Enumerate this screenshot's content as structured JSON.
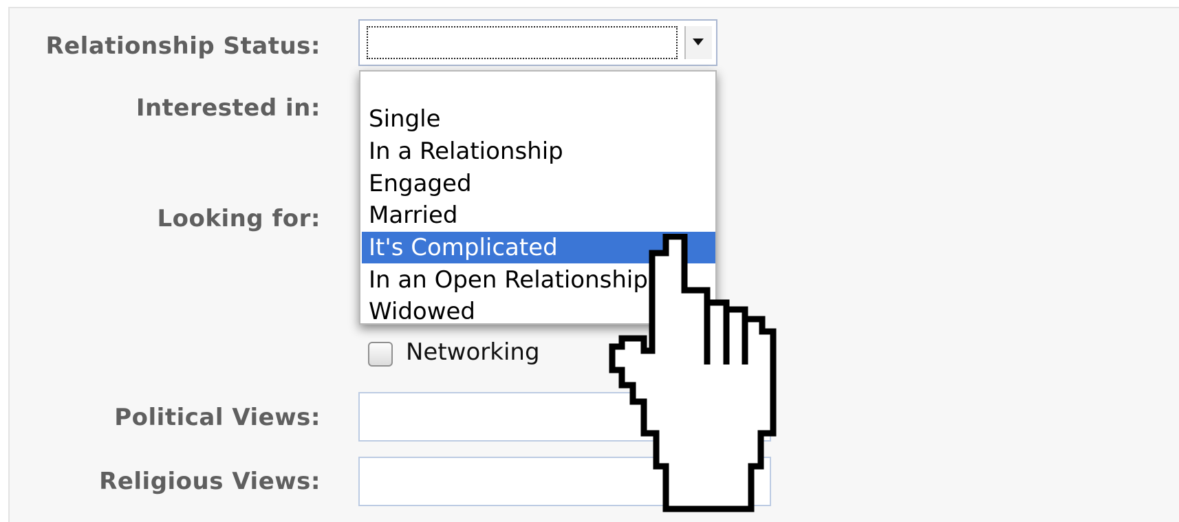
{
  "form": {
    "relationship_status": {
      "label": "Relationship Status:",
      "value": "",
      "options": [
        "",
        "Single",
        "In a Relationship",
        "Engaged",
        "Married",
        "It's Complicated",
        "In an Open Relationship",
        "Widowed"
      ],
      "highlighted": "It's Complicated"
    },
    "interested_in": {
      "label": "Interested in:"
    },
    "looking_for": {
      "label": "Looking for:",
      "visible_option": {
        "label": "Networking",
        "checked": false
      }
    },
    "political_views": {
      "label": "Political Views:",
      "value": ""
    },
    "religious_views": {
      "label": "Religious Views:",
      "value": ""
    }
  },
  "cursor": {
    "icon": "hand-pointer-icon"
  },
  "colors": {
    "highlight": "#3b76d6",
    "label_text": "#5f5f5f",
    "input_border": "#bccbe3"
  }
}
